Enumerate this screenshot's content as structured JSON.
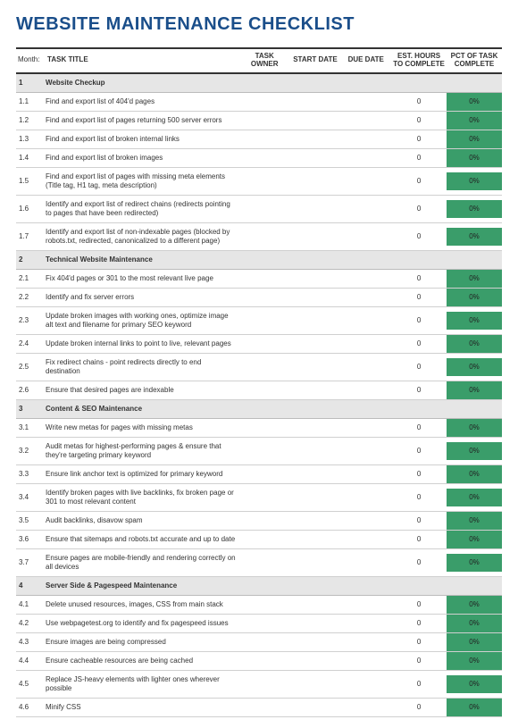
{
  "title": "WEBSITE MAINTENANCE CHECKLIST",
  "headers": {
    "month": "Month:",
    "task_title": "TASK TITLE",
    "task_owner": "TASK OWNER",
    "start_date": "START DATE",
    "due_date": "DUE DATE",
    "est_hours": "EST. HOURS TO COMPLETE",
    "pct": "PCT OF TASK COMPLETE"
  },
  "sections": [
    {
      "num": "1",
      "heading": "Website Checkup",
      "rows": [
        {
          "num": "1.1",
          "title": "Find and export list of 404'd pages",
          "owner": "",
          "start": "",
          "due": "",
          "hours": "0",
          "pct": "0%"
        },
        {
          "num": "1.2",
          "title": "Find and export list of pages returning 500 server errors",
          "owner": "",
          "start": "",
          "due": "",
          "hours": "0",
          "pct": "0%"
        },
        {
          "num": "1.3",
          "title": "Find and export list of broken internal links",
          "owner": "",
          "start": "",
          "due": "",
          "hours": "0",
          "pct": "0%"
        },
        {
          "num": "1.4",
          "title": "Find and export list of broken images",
          "owner": "",
          "start": "",
          "due": "",
          "hours": "0",
          "pct": "0%"
        },
        {
          "num": "1.5",
          "title": "Find and export list of pages with missing meta elements (Title tag, H1 tag, meta description)",
          "owner": "",
          "start": "",
          "due": "",
          "hours": "0",
          "pct": "0%"
        },
        {
          "num": "1.6",
          "title": "Identify and export list of redirect chains (redirects pointing to pages that have been redirected)",
          "owner": "",
          "start": "",
          "due": "",
          "hours": "0",
          "pct": "0%"
        },
        {
          "num": "1.7",
          "title": "Identify and export list of non-indexable pages (blocked by robots.txt, redirected, canonicalized to a different page)",
          "owner": "",
          "start": "",
          "due": "",
          "hours": "0",
          "pct": "0%"
        }
      ]
    },
    {
      "num": "2",
      "heading": "Technical Website Maintenance",
      "rows": [
        {
          "num": "2.1",
          "title": "Fix 404'd pages or 301 to the most relevant live page",
          "owner": "",
          "start": "",
          "due": "",
          "hours": "0",
          "pct": "0%"
        },
        {
          "num": "2.2",
          "title": "Identify and fix server errors",
          "owner": "",
          "start": "",
          "due": "",
          "hours": "0",
          "pct": "0%"
        },
        {
          "num": "2.3",
          "title": "Update broken images with working ones, optimize image alt text and filename for primary SEO keyword",
          "owner": "",
          "start": "",
          "due": "",
          "hours": "0",
          "pct": "0%"
        },
        {
          "num": "2.4",
          "title": "Update broken internal links to point to live, relevant pages",
          "owner": "",
          "start": "",
          "due": "",
          "hours": "0",
          "pct": "0%"
        },
        {
          "num": "2.5",
          "title": "Fix redirect chains - point redirects directly to end destination",
          "owner": "",
          "start": "",
          "due": "",
          "hours": "0",
          "pct": "0%"
        },
        {
          "num": "2.6",
          "title": "Ensure that desired pages are indexable",
          "owner": "",
          "start": "",
          "due": "",
          "hours": "0",
          "pct": "0%"
        }
      ]
    },
    {
      "num": "3",
      "heading": "Content & SEO Maintenance",
      "rows": [
        {
          "num": "3.1",
          "title": "Write new metas for pages with missing metas",
          "owner": "",
          "start": "",
          "due": "",
          "hours": "0",
          "pct": "0%"
        },
        {
          "num": "3.2",
          "title": "Audit metas for highest-performing pages & ensure that they're targeting primary keyword",
          "owner": "",
          "start": "",
          "due": "",
          "hours": "0",
          "pct": "0%"
        },
        {
          "num": "3.3",
          "title": "Ensure link anchor text is optimized for primary keyword",
          "owner": "",
          "start": "",
          "due": "",
          "hours": "0",
          "pct": "0%"
        },
        {
          "num": "3.4",
          "title": "Identify broken pages with live backlinks, fix broken page or 301 to most relevant content",
          "owner": "",
          "start": "",
          "due": "",
          "hours": "0",
          "pct": "0%"
        },
        {
          "num": "3.5",
          "title": "Audit backlinks, disavow spam",
          "owner": "",
          "start": "",
          "due": "",
          "hours": "0",
          "pct": "0%"
        },
        {
          "num": "3.6",
          "title": "Ensure that sitemaps and robots.txt accurate and up to date",
          "owner": "",
          "start": "",
          "due": "",
          "hours": "0",
          "pct": "0%"
        },
        {
          "num": "3.7",
          "title": "Ensure pages are mobile-friendly and rendering correctly on all devices",
          "owner": "",
          "start": "",
          "due": "",
          "hours": "0",
          "pct": "0%"
        }
      ]
    },
    {
      "num": "4",
      "heading": "Server Side & Pagespeed Maintenance",
      "rows": [
        {
          "num": "4.1",
          "title": "Delete unused resources, images, CSS from main stack",
          "owner": "",
          "start": "",
          "due": "",
          "hours": "0",
          "pct": "0%"
        },
        {
          "num": "4.2",
          "title": "Use webpagetest.org to identify and fix pagespeed issues",
          "owner": "",
          "start": "",
          "due": "",
          "hours": "0",
          "pct": "0%"
        },
        {
          "num": "4.3",
          "title": "Ensure images are being compressed",
          "owner": "",
          "start": "",
          "due": "",
          "hours": "0",
          "pct": "0%"
        },
        {
          "num": "4.4",
          "title": "Ensure cacheable resources are being cached",
          "owner": "",
          "start": "",
          "due": "",
          "hours": "0",
          "pct": "0%"
        },
        {
          "num": "4.5",
          "title": "Replace JS-heavy elements with lighter ones wherever possible",
          "owner": "",
          "start": "",
          "due": "",
          "hours": "0",
          "pct": "0%"
        },
        {
          "num": "4.6",
          "title": "Minify CSS",
          "owner": "",
          "start": "",
          "due": "",
          "hours": "0",
          "pct": "0%"
        }
      ]
    }
  ]
}
